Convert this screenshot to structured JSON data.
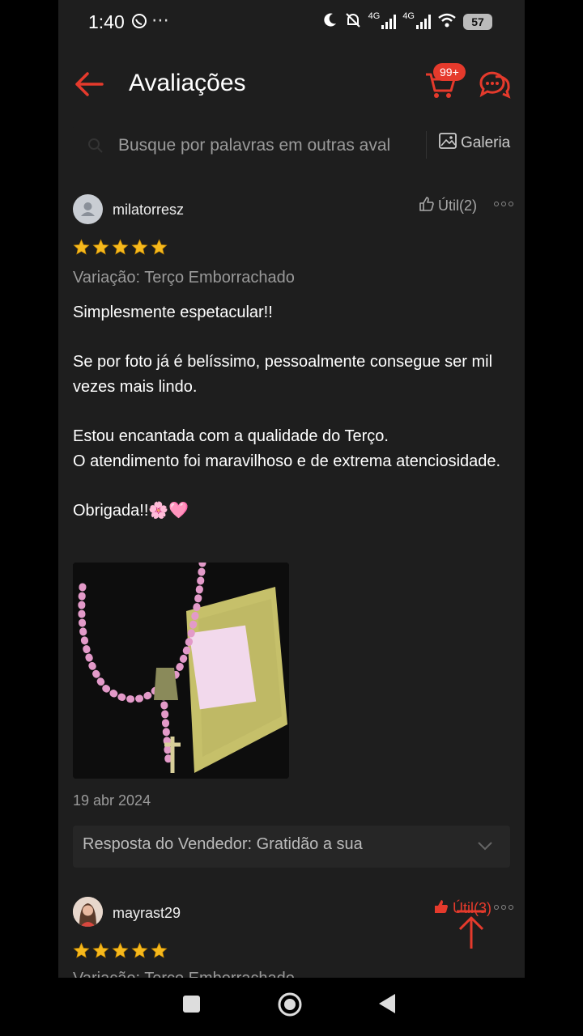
{
  "status_bar": {
    "time": "1:40",
    "extra": "⋯",
    "network1": "4G",
    "network2": "4G",
    "battery": "57"
  },
  "header": {
    "title": "Avaliações",
    "cart_badge": "99+"
  },
  "search": {
    "placeholder": "Busque por palavras em outras aval",
    "gallery_label": "Galeria"
  },
  "reviews": [
    {
      "username": "milatorresz",
      "util_label": "Útil(2)",
      "rating": 5,
      "variation": "Variação: Terço Emborrachado",
      "text_lines": [
        "Simplesmente espetacular!!",
        "",
        "Se por foto já é belíssimo, pessoalmente consegue ser mil vezes mais lindo.",
        "",
        "Estou encantada com a qualidade do Terço.",
        "O atendimento foi maravilhoso e de extrema atenciosidade.",
        "",
        "Obrigada!!🌸🩷"
      ],
      "date": "19 abr 2024",
      "seller_reply": "Resposta do Vendedor: Gratidão a sua"
    },
    {
      "username": "mayrast29",
      "util_label": "Útil(3)",
      "rating": 5,
      "variation": "Variação: Terço Emborrachado"
    }
  ],
  "colors": {
    "accent": "#e53a2c",
    "background": "#1e1e1e",
    "star": "#f6b91d",
    "muted": "#9a9a9a"
  }
}
